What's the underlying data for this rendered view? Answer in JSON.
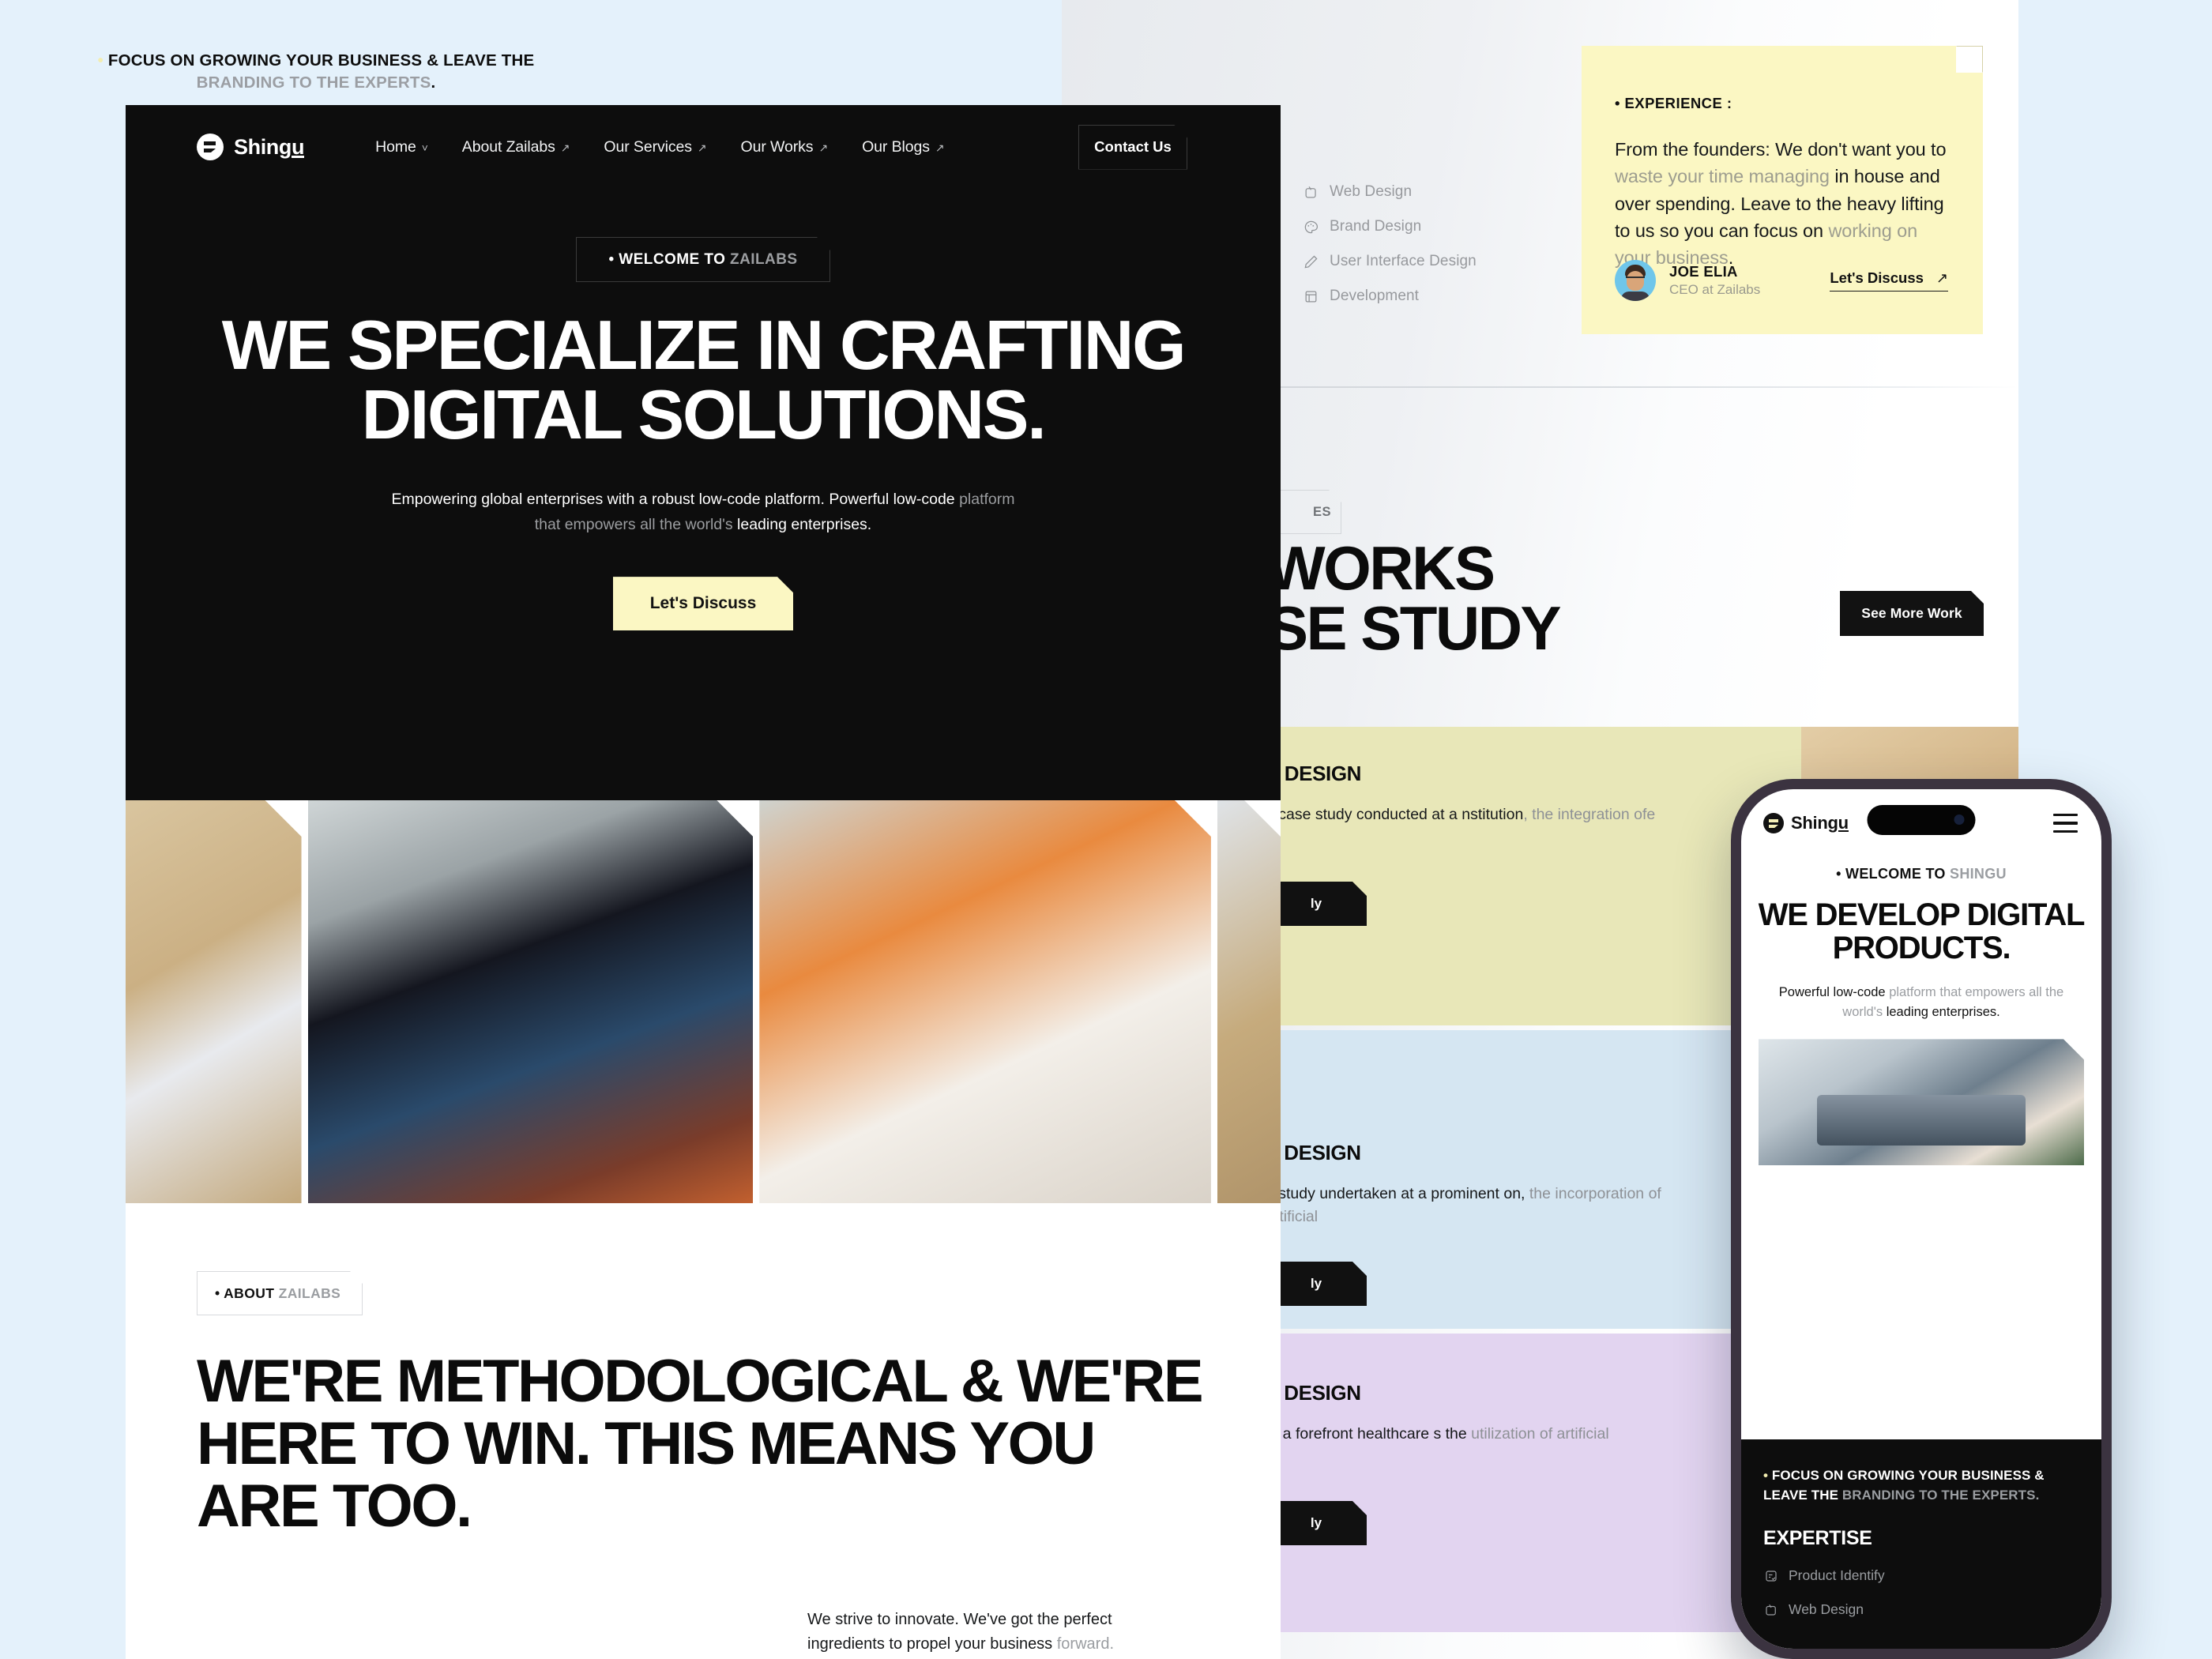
{
  "colors": {
    "page_background": "#e4f1fb",
    "hero_background": "#0d0d0d",
    "accent_yellow": "#fbf7c3",
    "card_yellow": "#e8e7b8",
    "card_blue": "#d5e6f2",
    "card_purple": "#e2d4f0"
  },
  "desktop": {
    "nav": {
      "logo": "Shingu",
      "logo_icon": "shingu-logo-icon",
      "items": [
        {
          "label": "Home",
          "icon": "chevron-down-icon"
        },
        {
          "label": "About Zailabs",
          "icon": "arrow-up-right-icon"
        },
        {
          "label": "Our Services",
          "icon": "arrow-up-right-icon"
        },
        {
          "label": "Our Works",
          "icon": "arrow-up-right-icon"
        },
        {
          "label": "Our Blogs",
          "icon": "arrow-up-right-icon"
        }
      ],
      "contact_label": "Contact Us"
    },
    "hero": {
      "tag_prefix": "• WELCOME TO ",
      "tag_brand": "ZAILABS",
      "headline": "WE SPECIALIZE IN CRAFTING DIGITAL SOLUTIONS.",
      "sub_strong_1": "Empowering global enterprises with a robust low-code platform. Powerful low-code ",
      "sub_muted": "platform that empowers all the world's ",
      "sub_strong_2": "leading enterprises.",
      "cta_label": "Let's Discuss"
    },
    "gallery": [
      {
        "name": "laptop-and-phone-on-desk"
      },
      {
        "name": "hand-holding-ipad-home-screen"
      },
      {
        "name": "tablet-on-sofa-with-orange-blanket"
      },
      {
        "name": "desk-with-glasses-and-notebook"
      }
    ],
    "about": {
      "tag_prefix": "• ABOUT ",
      "tag_brand": "ZAILABS",
      "headline": "WE'RE METHODOLOGICAL & WE'RE HERE TO WIN. THIS MEANS YOU ARE TOO.",
      "paragraph_strong": "We strive to innovate. We've got the perfect ingredients to propel your business ",
      "paragraph_muted": "forward."
    }
  },
  "right_panel": {
    "focus": {
      "dot": "•",
      "strong_1": " FOCUS ON GROWING YOUR BUSINESS & LEAVE THE ",
      "muted": "BRANDING TO THE EXPERTS",
      "strong_2": "."
    },
    "services": [
      {
        "label": "Web Design",
        "icon": "cursor-box-icon"
      },
      {
        "label": "Brand Design",
        "icon": "palette-icon"
      },
      {
        "label": "User Interface Design",
        "icon": "pen-icon"
      },
      {
        "label": "Development",
        "icon": "layout-icon"
      }
    ],
    "experience_card": {
      "kicker": "• EXPERIENCE :",
      "body_1": "From the founders:  We don't want you to ",
      "body_muted_1": "waste your time managing ",
      "body_2": "in house and over spending. Leave to the heavy lifting to us so you can focus on ",
      "body_muted_2": "working on your business",
      "body_3": ".",
      "author_name": "JOE ELIA",
      "author_role": "CEO at Zailabs",
      "link_label": "Let's Discuss",
      "link_icon": "arrow-up-right-icon"
    },
    "works": {
      "tag": "ES",
      "headline_line_1": "WORKS",
      "headline_line_2": "SE STUDY",
      "see_more_label": "See More Work"
    },
    "cases": [
      {
        "title": "E DESIGN",
        "desc_strong": "g case study conducted at a ",
        "desc_mid": "nstitution",
        "desc_muted": ", the integration of",
        "desc_tail": "e",
        "button_label": "ly",
        "bg": "#e8e7b8",
        "photo": "hands-typing-on-desk"
      },
      {
        "title": "P DESIGN",
        "desc_strong": "e study undertaken at a prominent ",
        "desc_mid": "on,",
        "desc_muted": " the incorporation of artificial",
        "desc_tail": "",
        "button_label": "ly",
        "bg": "#d5e6f2",
        "photo": "tablet-on-sofa-with-orange-blanket"
      },
      {
        "title": "P DESIGN",
        "desc_strong": "at a forefront healthcare ",
        "desc_mid": "s the",
        "desc_muted": " utilization of artificial",
        "desc_tail": "",
        "button_label": "ly",
        "bg": "#e2d4f0",
        "photo": "hand-holding-phone"
      }
    ]
  },
  "phone": {
    "logo": "Shingu",
    "logo_icon": "shingu-logo-icon",
    "menu_icon": "hamburger-menu-icon",
    "welcome_prefix": "• WELCOME TO ",
    "welcome_brand": "SHINGU",
    "headline": "WE DEVELOP DIGITAL PRODUCTS.",
    "sub_strong_1": "Powerful low-code ",
    "sub_muted": "platform that empowers all the world's ",
    "sub_strong_2": "leading enterprises.",
    "photo": "office-team-working",
    "focus_dot": "•",
    "focus_strong": " FOCUS ON GROWING YOUR BUSINESS & LEAVE THE ",
    "focus_muted": "BRANDING TO THE EXPERTS.",
    "expertise_title": "EXPERTISE",
    "expertise": [
      {
        "label": "Product Identify",
        "icon": "document-check-icon"
      },
      {
        "label": "Web Design",
        "icon": "cursor-box-icon"
      }
    ]
  }
}
